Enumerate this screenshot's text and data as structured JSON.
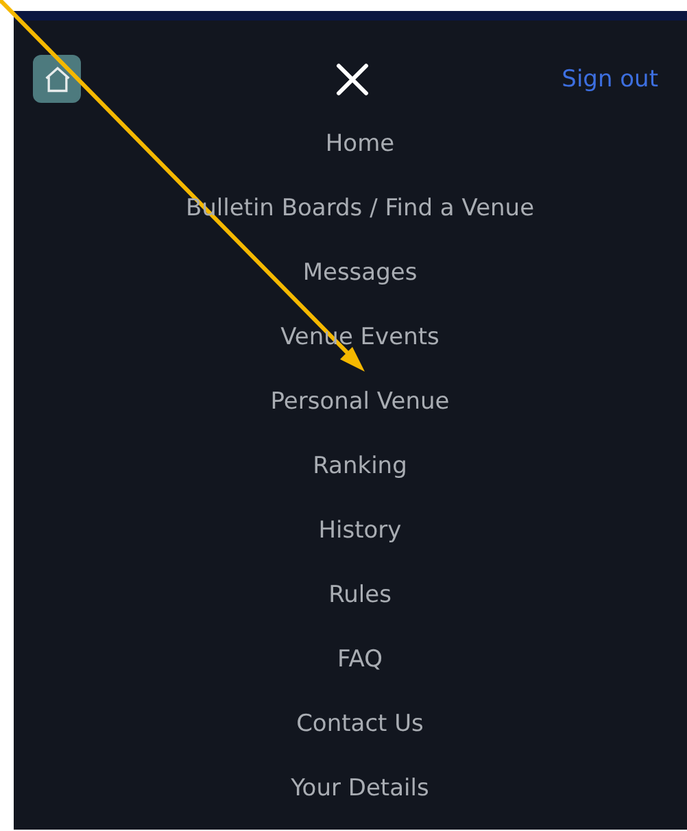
{
  "header": {
    "sign_out": "Sign out"
  },
  "menu": [
    "Home",
    "Bulletin Boards / Find a Venue",
    "Messages",
    "Venue Events",
    "Personal Venue",
    "Ranking",
    "History",
    "Rules",
    "FAQ",
    "Contact Us",
    "Your Details"
  ]
}
